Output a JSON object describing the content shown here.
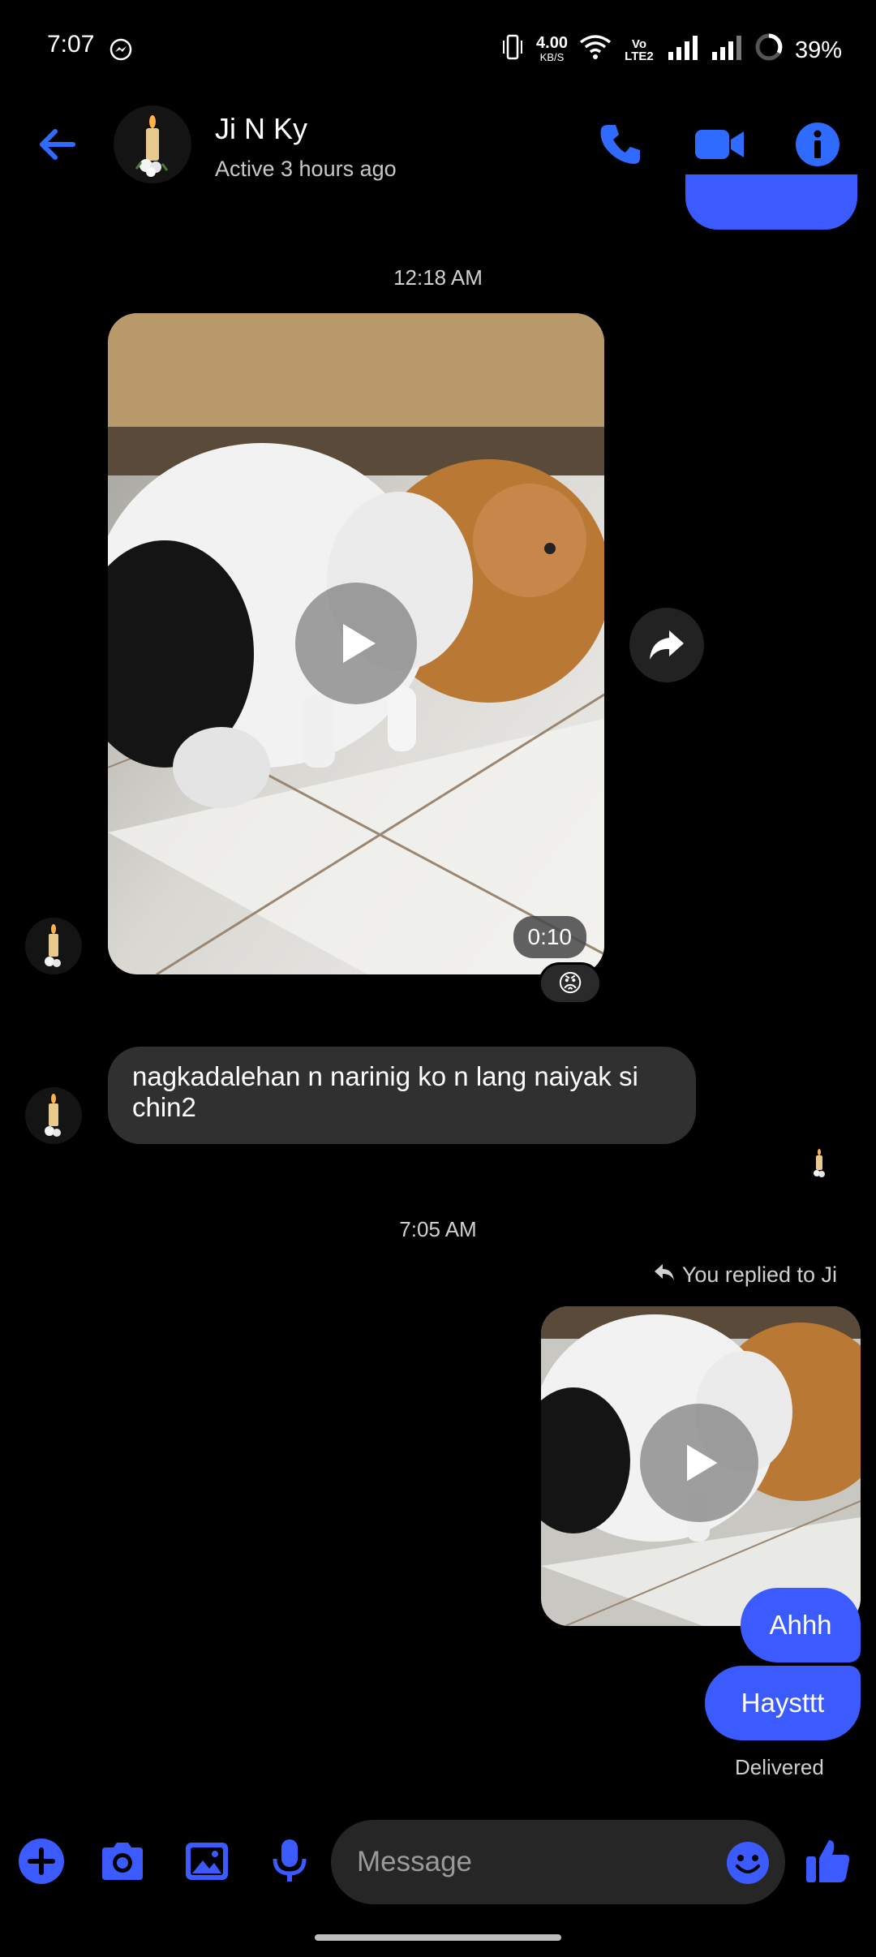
{
  "status_bar": {
    "time": "7:07",
    "net_speed": "4.00",
    "net_unit": "KB/S",
    "volte": "Vo LTE2",
    "battery": "39%"
  },
  "header": {
    "name": "Ji N Ky",
    "status": "Active 3 hours ago"
  },
  "thread": {
    "timestamp1": "12:18 AM",
    "video1_duration": "0:10",
    "reaction": "😡",
    "incoming_text": "nagkadalehan n narinig ko n lang naiyak si chin2",
    "timestamp2": "7:05 AM",
    "reply_note": "You replied to Ji",
    "out_messages": [
      "Ahhh",
      "Haysttt"
    ],
    "delivered": "Delivered"
  },
  "composer": {
    "placeholder": "Message"
  },
  "colors": {
    "accent": "#3b5bff",
    "bg": "#000000",
    "incoming_bubble": "#303030"
  }
}
